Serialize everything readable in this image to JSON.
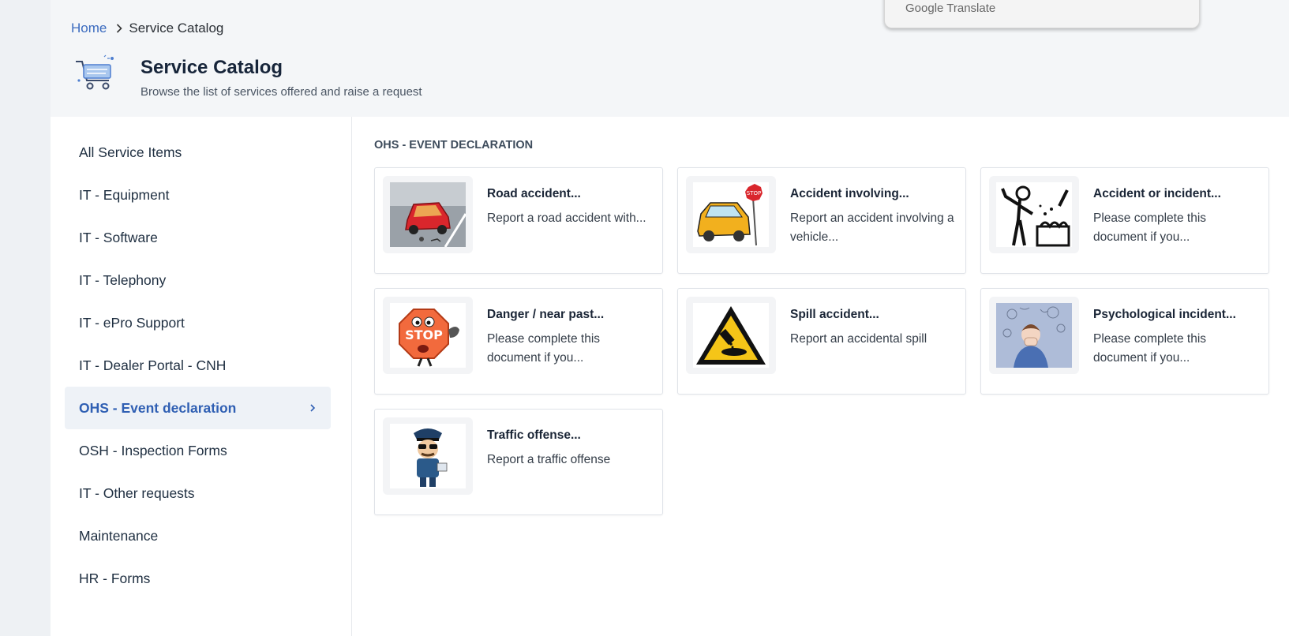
{
  "breadcrumb": {
    "home": "Home",
    "current": "Service Catalog"
  },
  "header": {
    "title": "Service Catalog",
    "subtitle": "Browse the list of services offered and raise a request",
    "icon": "shopping-cart-icon"
  },
  "translate_popup": {
    "label": "Google Translate"
  },
  "sidebar": {
    "items": [
      {
        "label": "All Service Items"
      },
      {
        "label": "IT - Equipment"
      },
      {
        "label": "IT - Software"
      },
      {
        "label": "IT - Telephony"
      },
      {
        "label": "IT - ePro Support"
      },
      {
        "label": "IT - Dealer Portal - CNH"
      },
      {
        "label": "OHS - Event declaration",
        "active": true
      },
      {
        "label": "OSH - Inspection Forms"
      },
      {
        "label": "IT - Other requests"
      },
      {
        "label": "Maintenance"
      },
      {
        "label": "HR - Forms"
      }
    ]
  },
  "section": {
    "title": "OHS - EVENT DECLARATION"
  },
  "cards": [
    {
      "title": "Road accident...",
      "description": "Report a road accident with...",
      "image": "road-accident-image"
    },
    {
      "title": "Accident involving...",
      "description": "Report an accident involving a vehicle...",
      "image": "car-crash-stop-sign-image"
    },
    {
      "title": "Accident or incident...",
      "description": "Please complete this document if you...",
      "image": "person-burn-incident-image"
    },
    {
      "title": "Danger / near past...",
      "description": "Please complete this document if you...",
      "image": "stop-sign-character-image"
    },
    {
      "title": "Spill accident...",
      "description": "Report an accidental spill",
      "image": "spill-warning-sign-image"
    },
    {
      "title": "Psychological incident...",
      "description": "Please complete this document if you...",
      "image": "stressed-person-image"
    },
    {
      "title": "Traffic offense...",
      "description": "Report a traffic offense",
      "image": "police-officer-image"
    }
  ],
  "colors": {
    "accent": "#2f5fb3",
    "link": "#3b6bbf",
    "header_bg": "#f4f6f8"
  }
}
